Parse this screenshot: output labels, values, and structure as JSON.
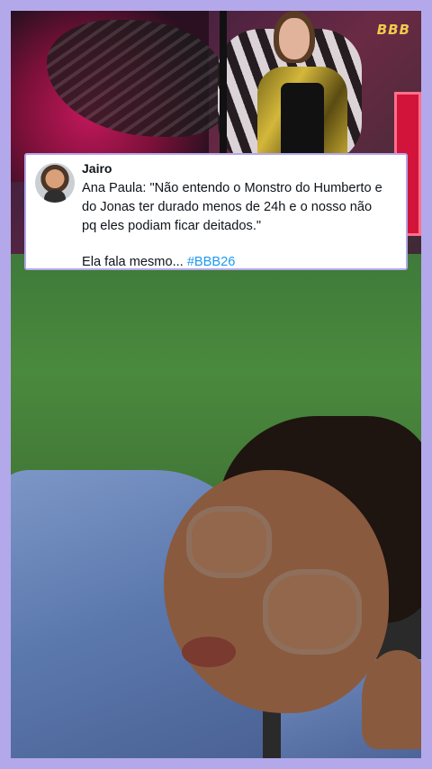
{
  "channel_logo": "BBB",
  "tweet": {
    "author": "Jairo",
    "avatar_icon": "user-avatar-icon",
    "text_lines": [
      "Ana Paula: \"Não entendo o Monstro do Humberto e",
      "do Jonas ter durado menos de 24h e o nosso não",
      "pq eles podiam ficar deitados.\""
    ],
    "footer_text": "Ela fala mesmo...",
    "hashtag": "#BBB26",
    "hashtag_color": "#1d9bf0"
  },
  "colors": {
    "frame_border": "#b3a8ea"
  }
}
